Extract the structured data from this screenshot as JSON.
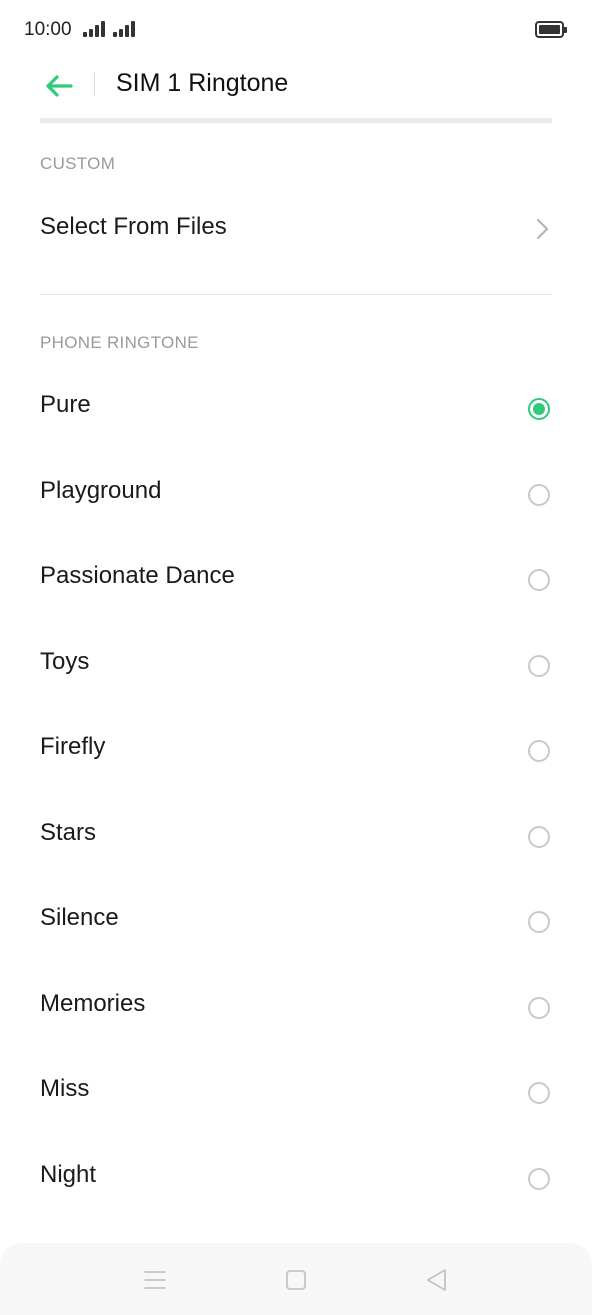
{
  "status": {
    "time": "10:00"
  },
  "header": {
    "title": "SIM 1 Ringtone"
  },
  "custom_section": {
    "label": "CUSTOM",
    "select_files_label": "Select From Files"
  },
  "ringtone_section": {
    "label": "PHONE RINGTONE",
    "items": [
      {
        "label": "Pure",
        "selected": true
      },
      {
        "label": "Playground",
        "selected": false
      },
      {
        "label": "Passionate Dance",
        "selected": false
      },
      {
        "label": "Toys",
        "selected": false
      },
      {
        "label": "Firefly",
        "selected": false
      },
      {
        "label": "Stars",
        "selected": false
      },
      {
        "label": "Silence",
        "selected": false
      },
      {
        "label": "Memories",
        "selected": false
      },
      {
        "label": "Miss",
        "selected": false
      },
      {
        "label": "Night",
        "selected": false
      }
    ]
  },
  "colors": {
    "accent": "#2ecb7a",
    "text": "#1a1a1a",
    "muted": "#9a9a9a"
  }
}
